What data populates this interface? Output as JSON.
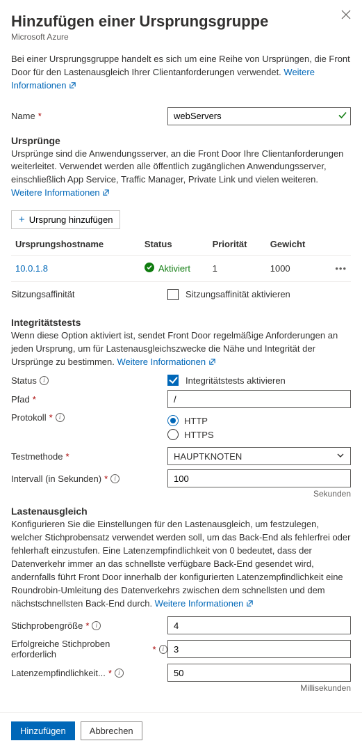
{
  "header": {
    "title": "Hinzufügen einer Ursprungsgruppe",
    "subtitle": "Microsoft Azure"
  },
  "intro": {
    "text": "Bei einer Ursprungsgruppe handelt es sich um eine Reihe von Ursprüngen, die Front Door für den Lastenausgleich Ihrer Clientanforderungen verwendet. ",
    "learn_more": "Weitere Informationen"
  },
  "name": {
    "label": "Name",
    "value": "webServers"
  },
  "origins": {
    "heading": "Ursprünge",
    "desc_before_link": "Ursprünge sind die Anwendungsserver, an die Front Door Ihre Clientanforderungen weiterleitet. Verwendet werden alle öffentlich zugänglichen Anwendungsserver, einschließlich App Service, Traffic Manager, Private Link und vielen weiteren. ",
    "learn_more": "Weitere Informationen",
    "add_button": "Ursprung hinzufügen",
    "columns": {
      "host": "Ursprungshostname",
      "status": "Status",
      "priority": "Priorität",
      "weight": "Gewicht"
    },
    "rows": [
      {
        "host": "10.0.1.8",
        "status": "Aktiviert",
        "priority": "1",
        "weight": "1000"
      }
    ]
  },
  "session_affinity": {
    "label": "Sitzungsaffinität",
    "checkbox_label": "Sitzungsaffinität aktivieren",
    "checked": false
  },
  "health_probes": {
    "heading": "Integritätstests",
    "desc_before_link": "Wenn diese Option aktiviert ist, sendet Front Door regelmäßige Anforderungen an jeden Ursprung, um für Lastenausgleichszwecke die Nähe und Integrität der Ursprünge zu bestimmen. ",
    "learn_more": "Weitere Informationen",
    "status_label": "Status",
    "status_checkbox_label": "Integritätstests aktivieren",
    "path_label": "Pfad",
    "path_value": "/",
    "protocol_label": "Protokoll",
    "protocol_http": "HTTP",
    "protocol_https": "HTTPS",
    "method_label": "Testmethode",
    "method_value": "HAUPTKNOTEN",
    "interval_label": "Intervall (in Sekunden)",
    "interval_value": "100",
    "interval_unit": "Sekunden"
  },
  "load_balancing": {
    "heading": "Lastenausgleich",
    "desc_before_link": "Konfigurieren Sie die Einstellungen für den Lastenausgleich, um festzulegen, welcher Stichprobensatz verwendet werden soll, um das Back-End als fehlerfrei oder fehlerhaft einzustufen. Eine Latenzempfindlichkeit von 0 bedeutet, dass der Datenverkehr immer an das schnellste verfügbare Back-End gesendet wird, andernfalls führt Front Door innerhalb der konfigurierten Latenzempfindlichkeit eine Roundrobin-Umleitung des Datenverkehrs zwischen dem schnellsten und dem nächstschnellsten Back-End durch. ",
    "learn_more": "Weitere Informationen",
    "sample_size_label": "Stichprobengröße",
    "sample_size_value": "4",
    "successful_label": "Erfolgreiche Stichproben erforderlich",
    "successful_value": "3",
    "latency_label": "Latenzempfindlichkeit...",
    "latency_value": "50",
    "latency_unit": "Millisekunden"
  },
  "footer": {
    "submit": "Hinzufügen",
    "cancel": "Abbrechen"
  }
}
